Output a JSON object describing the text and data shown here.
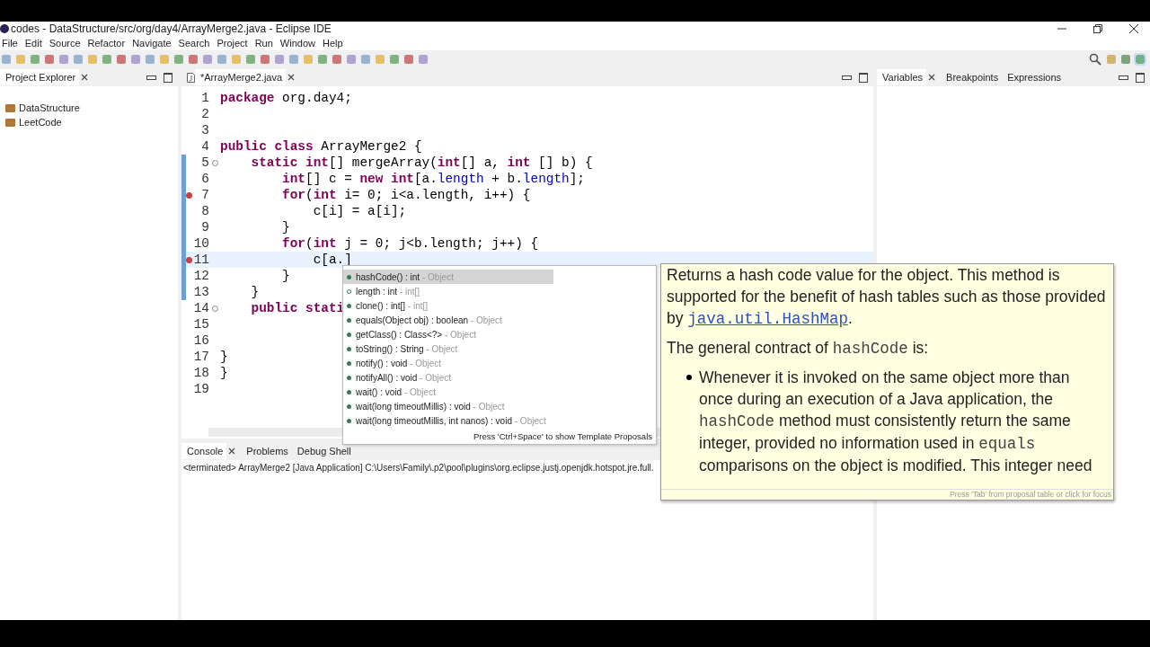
{
  "window": {
    "title": "codes - DataStructure/src/org/day4/ArrayMerge2.java - Eclipse IDE"
  },
  "menu": [
    "File",
    "Edit",
    "Source",
    "Refactor",
    "Navigate",
    "Search",
    "Project",
    "Run",
    "Window",
    "Help"
  ],
  "project_explorer": {
    "title": "Project Explorer",
    "items": [
      {
        "label": "DataStructure"
      },
      {
        "label": "LeetCode"
      }
    ]
  },
  "editor": {
    "tab": "*ArrayMerge2.java",
    "lines": [
      {
        "number": "1",
        "error": false,
        "foldable": false,
        "changed": false,
        "current": false,
        "tokens": [
          {
            "kind": "kw",
            "text": "package"
          },
          {
            "kind": "plain",
            "text": " org.day4;"
          }
        ]
      },
      {
        "number": "2",
        "error": false,
        "foldable": false,
        "changed": false,
        "current": false
      },
      {
        "number": "3",
        "error": false,
        "foldable": false,
        "changed": false,
        "current": false
      },
      {
        "number": "4",
        "error": false,
        "foldable": false,
        "changed": false,
        "current": false,
        "tokens": [
          {
            "kind": "kw",
            "text": "public"
          },
          {
            "kind": "kw",
            "text": " class"
          },
          {
            "kind": "plain",
            "text": " ArrayMerge2 {"
          }
        ]
      },
      {
        "number": "5",
        "error": false,
        "foldable": true,
        "changed": true,
        "current": false,
        "tokens": [
          {
            "kind": "kw",
            "text": "    static"
          },
          {
            "kind": "kw",
            "text": " int"
          },
          {
            "kind": "plain",
            "text": "[] mergeArray("
          },
          {
            "kind": "kw",
            "text": "int"
          },
          {
            "kind": "plain",
            "text": "[] a, "
          },
          {
            "kind": "kw",
            "text": "int"
          },
          {
            "kind": "plain",
            "text": " [] b) {"
          }
        ]
      },
      {
        "number": "6",
        "error": false,
        "foldable": false,
        "changed": true,
        "current": false,
        "tokens": [
          {
            "kind": "kw",
            "text": "        int"
          },
          {
            "kind": "plain",
            "text": "[] c = "
          },
          {
            "kind": "kw",
            "text": "new"
          },
          {
            "kind": "kw",
            "text": " int"
          },
          {
            "kind": "plain",
            "text": "[a."
          },
          {
            "kind": "field",
            "text": "length"
          },
          {
            "kind": "plain",
            "text": " + b."
          },
          {
            "kind": "field",
            "text": "length"
          },
          {
            "kind": "plain",
            "text": "];"
          }
        ]
      },
      {
        "number": "7",
        "error": true,
        "foldable": false,
        "changed": true,
        "current": false,
        "tokens": [
          {
            "kind": "kw",
            "text": "        for"
          },
          {
            "kind": "plain",
            "text": "("
          },
          {
            "kind": "kw",
            "text": "int"
          },
          {
            "kind": "plain",
            "text": " i= 0; i<a.length, i++) {"
          }
        ]
      },
      {
        "number": "8",
        "error": false,
        "foldable": false,
        "changed": true,
        "current": false,
        "tokens": [
          {
            "kind": "plain",
            "text": "            c[i] = a[i];"
          }
        ]
      },
      {
        "number": "9",
        "error": false,
        "foldable": false,
        "changed": true,
        "current": false,
        "tokens": [
          {
            "kind": "plain",
            "text": "        }"
          }
        ]
      },
      {
        "number": "10",
        "error": false,
        "foldable": false,
        "changed": true,
        "current": false,
        "tokens": [
          {
            "kind": "kw",
            "text": "        for"
          },
          {
            "kind": "plain",
            "text": "("
          },
          {
            "kind": "kw",
            "text": "int"
          },
          {
            "kind": "plain",
            "text": " j = 0; j<b.length; j++) {"
          }
        ]
      },
      {
        "number": "11",
        "error": true,
        "foldable": false,
        "changed": true,
        "current": true,
        "tokens": [
          {
            "kind": "plain",
            "text": "            c[a.]"
          }
        ]
      },
      {
        "number": "12",
        "error": false,
        "foldable": false,
        "changed": true,
        "current": false,
        "tokens": [
          {
            "kind": "plain",
            "text": "        }"
          }
        ]
      },
      {
        "number": "13",
        "error": false,
        "foldable": false,
        "changed": true,
        "current": false,
        "tokens": [
          {
            "kind": "plain",
            "text": "    }"
          }
        ]
      },
      {
        "number": "14",
        "error": false,
        "foldable": true,
        "changed": false,
        "current": false,
        "tokens": [
          {
            "kind": "kw",
            "text": "    public"
          },
          {
            "kind": "kw",
            "text": " stati"
          }
        ]
      },
      {
        "number": "15",
        "error": false,
        "foldable": false,
        "changed": false,
        "current": false
      },
      {
        "number": "16",
        "error": false,
        "foldable": false,
        "changed": false,
        "current": false
      },
      {
        "number": "17",
        "error": false,
        "foldable": false,
        "changed": false,
        "current": false,
        "tokens": [
          {
            "kind": "plain",
            "text": "}"
          }
        ]
      },
      {
        "number": "18",
        "error": false,
        "foldable": false,
        "changed": false,
        "current": false,
        "tokens": [
          {
            "kind": "plain",
            "text": "}"
          }
        ]
      },
      {
        "number": "19",
        "error": false,
        "foldable": false,
        "changed": false,
        "current": false
      }
    ]
  },
  "debug_tabs": [
    {
      "label": "Variables",
      "selected": true
    },
    {
      "label": "Breakpoints",
      "selected": false
    },
    {
      "label": "Expressions",
      "selected": false
    }
  ],
  "console": {
    "tabs": [
      {
        "label": "Console",
        "selected": true
      },
      {
        "label": "Problems",
        "selected": false
      },
      {
        "label": "Debug Shell",
        "selected": false
      }
    ],
    "status": "<terminated> ArrayMerge2 [Java Application] C:\\Users\\Family\\.p2\\pool\\plugins\\org.eclipse.justj.openjdk.hotspot.jre.full."
  },
  "completion": {
    "items": [
      {
        "signature": "hashCode() : int",
        "owner": "- Object",
        "kind": "method",
        "selected": true
      },
      {
        "signature": "length : int",
        "owner": "- int[]",
        "kind": "field",
        "selected": false
      },
      {
        "signature": "clone() : int[]",
        "owner": "- int[]",
        "kind": "method",
        "selected": false
      },
      {
        "signature": "equals(Object obj) : boolean",
        "owner": "- Object",
        "kind": "method",
        "selected": false
      },
      {
        "signature": "getClass() : Class<?>",
        "owner": "- Object",
        "kind": "method",
        "selected": false
      },
      {
        "signature": "toString() : String",
        "owner": "- Object",
        "kind": "method",
        "selected": false
      },
      {
        "signature": "notify() : void",
        "owner": "- Object",
        "kind": "method",
        "selected": false
      },
      {
        "signature": "notifyAll() : void",
        "owner": "- Object",
        "kind": "method",
        "selected": false
      },
      {
        "signature": "wait() : void",
        "owner": "- Object",
        "kind": "method",
        "selected": false
      },
      {
        "signature": "wait(long timeoutMillis) : void",
        "owner": "- Object",
        "kind": "method",
        "selected": false
      },
      {
        "signature": "wait(long timeoutMillis, int nanos) : void",
        "owner": "- Object",
        "kind": "method",
        "selected": false
      }
    ],
    "footer": "Press 'Ctrl+Space' to show Template Proposals"
  },
  "javadoc": {
    "blocks": [
      {
        "kind": "paragraph",
        "segments": [
          {
            "kind": "text",
            "text": "Returns a hash code value for the object. This method is supported for the benefit of hash tables such as those provided by "
          },
          {
            "kind": "link",
            "text": "java.util.HashMap"
          },
          {
            "kind": "text",
            "text": "."
          }
        ]
      },
      {
        "kind": "paragraph",
        "segments": [
          {
            "kind": "text",
            "text": "The general contract of "
          },
          {
            "kind": "code",
            "text": "hashCode"
          },
          {
            "kind": "text",
            "text": " is:"
          }
        ]
      },
      {
        "kind": "bullet",
        "segments": [
          {
            "kind": "text",
            "text": "Whenever it is invoked on the same object more than once during an execution of a Java application, the "
          },
          {
            "kind": "code",
            "text": "hashCode"
          },
          {
            "kind": "text",
            "text": " method must consistently return the same integer, provided no information used in "
          },
          {
            "kind": "code",
            "text": "equals"
          },
          {
            "kind": "text",
            "text": " comparisons on the object is modified. This integer need"
          }
        ]
      }
    ],
    "footer": "Press 'Tab' from proposal table or click for focus"
  }
}
